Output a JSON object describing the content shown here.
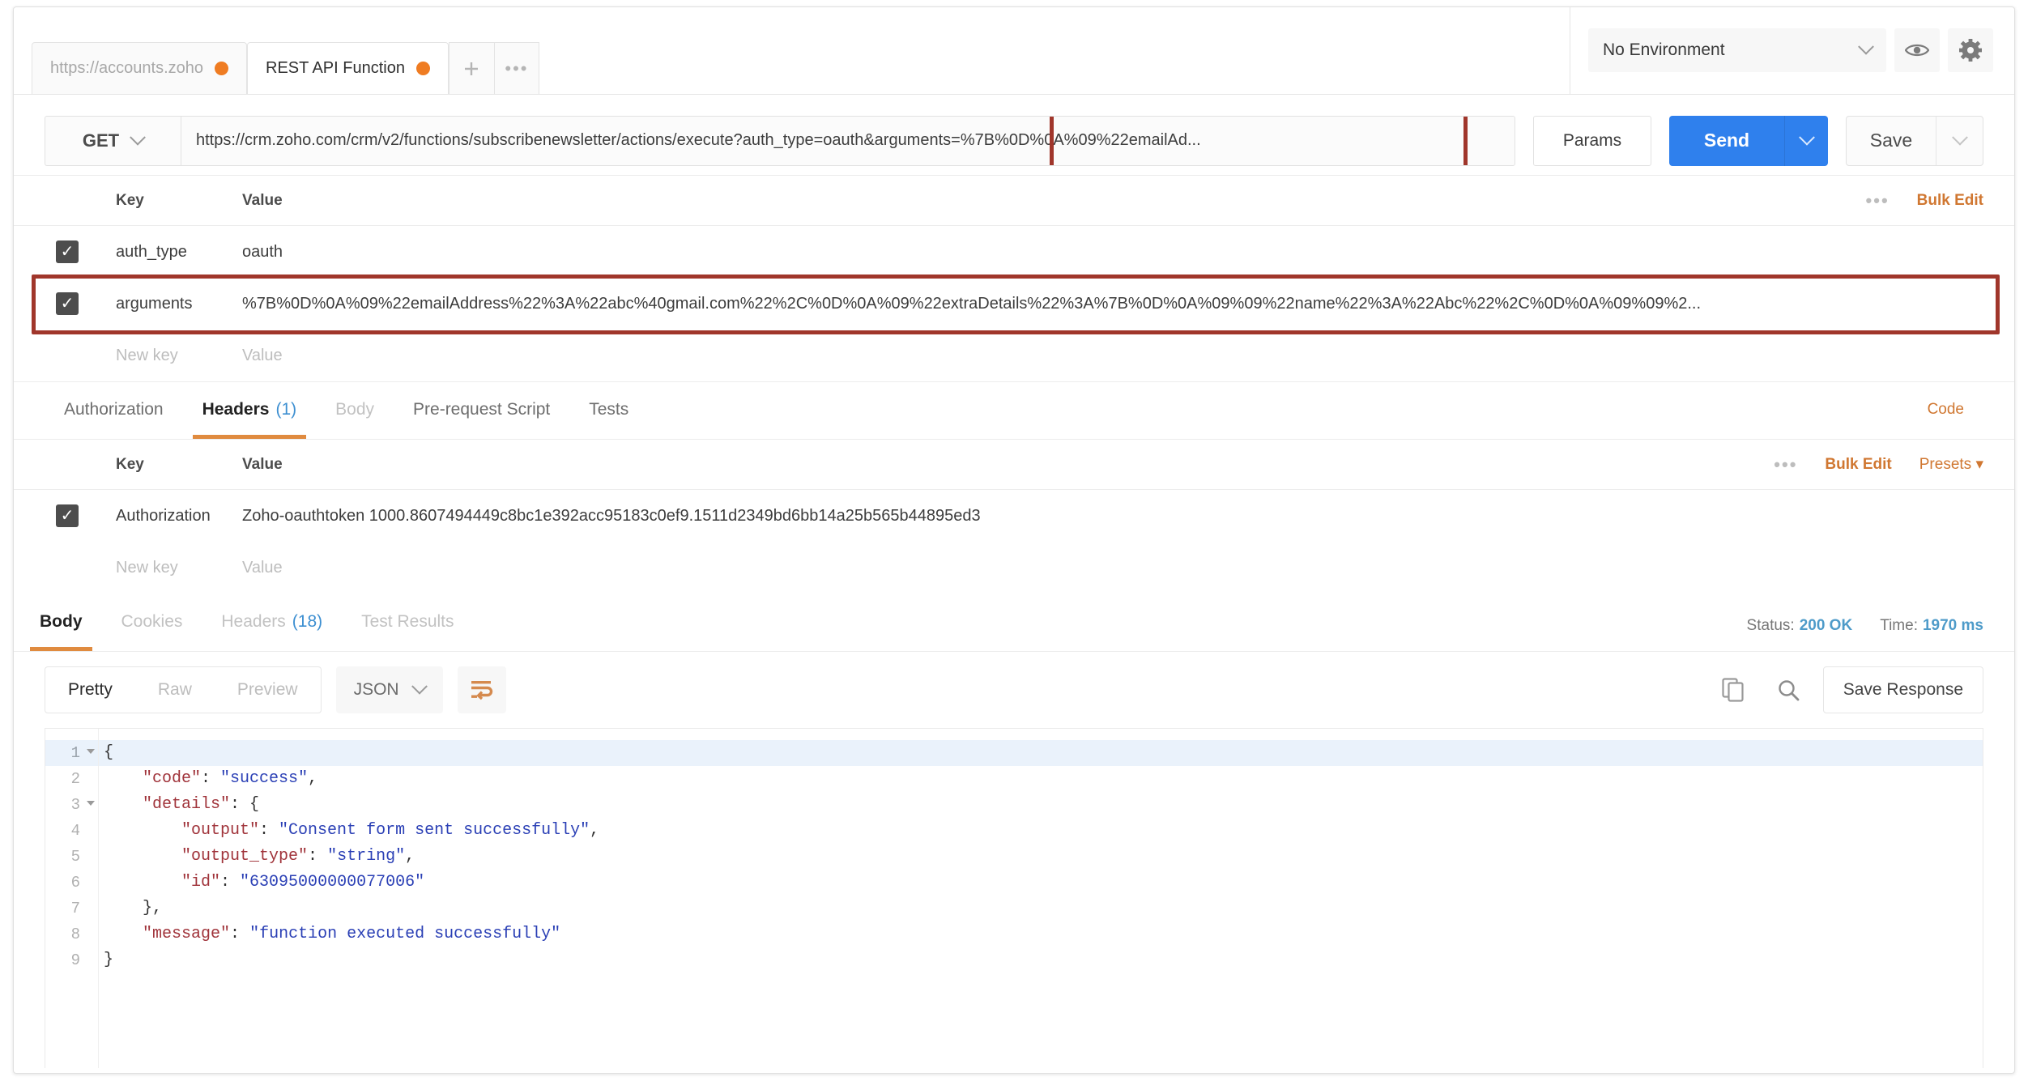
{
  "tabs": {
    "items": [
      {
        "label": "https://accounts.zoho",
        "active": false,
        "unsaved": true
      },
      {
        "label": "REST API Function",
        "active": true,
        "unsaved": true
      }
    ],
    "new_tab_icon": "plus-icon",
    "more_icon": "ellipsis-icon"
  },
  "environment": {
    "selected": "No Environment",
    "eye_icon": "eye-icon",
    "settings_icon": "gear-icon"
  },
  "request": {
    "method": "GET",
    "url": "https://crm.zoho.com/crm/v2/functions/subscribenewsletter/actions/execute?auth_type=oauth&arguments=%7B%0D%0A%09%22emailAd...",
    "params_label": "Params",
    "send_label": "Send",
    "save_label": "Save",
    "highlight_color": "#a0362b",
    "send_color": "#2f80ed"
  },
  "params_table": {
    "headers": {
      "key": "Key",
      "value": "Value"
    },
    "bulk_edit_label": "Bulk Edit",
    "more_icon": "ellipsis-icon",
    "rows": [
      {
        "checked": true,
        "key": "auth_type",
        "value": "oauth",
        "highlighted": false
      },
      {
        "checked": true,
        "key": "arguments",
        "value": "%7B%0D%0A%09%22emailAddress%22%3A%22abc%40gmail.com%22%2C%0D%0A%09%22extraDetails%22%3A%7B%0D%0A%09%09%22name%22%3A%22Abc%22%2C%0D%0A%09%09%2...",
        "highlighted": true
      }
    ],
    "new_row": {
      "key_placeholder": "New key",
      "value_placeholder": "Value"
    }
  },
  "request_tabs": {
    "items": [
      {
        "label": "Authorization",
        "state": "normal"
      },
      {
        "label": "Headers",
        "count": "(1)",
        "state": "active"
      },
      {
        "label": "Body",
        "state": "muted"
      },
      {
        "label": "Pre-request Script",
        "state": "normal"
      },
      {
        "label": "Tests",
        "state": "normal"
      }
    ],
    "code_label": "Code"
  },
  "headers_table": {
    "headers": {
      "key": "Key",
      "value": "Value"
    },
    "bulk_edit_label": "Bulk Edit",
    "presets_label": "Presets",
    "more_icon": "ellipsis-icon",
    "rows": [
      {
        "checked": true,
        "key": "Authorization",
        "value": "Zoho-oauthtoken 1000.8607494449c8bc1e392acc95183c0ef9.1511d2349bd6bb14a25b565b44895ed3"
      }
    ],
    "new_row": {
      "key_placeholder": "New key",
      "value_placeholder": "Value"
    }
  },
  "response": {
    "tabs": [
      {
        "label": "Body",
        "state": "active"
      },
      {
        "label": "Cookies",
        "state": "muted"
      },
      {
        "label": "Headers",
        "count": "(18)",
        "state": "muted"
      },
      {
        "label": "Test Results",
        "state": "muted"
      }
    ],
    "status_label": "Status:",
    "status_value": "200 OK",
    "time_label": "Time:",
    "time_value": "1970 ms",
    "view_modes": [
      {
        "label": "Pretty",
        "active": true
      },
      {
        "label": "Raw",
        "active": false
      },
      {
        "label": "Preview",
        "active": false
      }
    ],
    "format": "JSON",
    "wrap_icon": "word-wrap-icon",
    "copy_icon": "copy-icon",
    "search_icon": "search-icon",
    "save_response_label": "Save Response"
  },
  "response_body": {
    "lines": [
      {
        "n": "1",
        "fold": true,
        "indent": 0,
        "segments": [
          {
            "t": "pun",
            "v": "{"
          }
        ]
      },
      {
        "n": "2",
        "fold": false,
        "indent": 1,
        "segments": [
          {
            "t": "key",
            "v": "\"code\""
          },
          {
            "t": "pun",
            "v": ": "
          },
          {
            "t": "str",
            "v": "\"success\""
          },
          {
            "t": "pun",
            "v": ","
          }
        ]
      },
      {
        "n": "3",
        "fold": true,
        "indent": 1,
        "segments": [
          {
            "t": "key",
            "v": "\"details\""
          },
          {
            "t": "pun",
            "v": ": {"
          }
        ]
      },
      {
        "n": "4",
        "fold": false,
        "indent": 2,
        "segments": [
          {
            "t": "key",
            "v": "\"output\""
          },
          {
            "t": "pun",
            "v": ": "
          },
          {
            "t": "str",
            "v": "\"Consent form sent successfully\""
          },
          {
            "t": "pun",
            "v": ","
          }
        ]
      },
      {
        "n": "5",
        "fold": false,
        "indent": 2,
        "segments": [
          {
            "t": "key",
            "v": "\"output_type\""
          },
          {
            "t": "pun",
            "v": ": "
          },
          {
            "t": "str",
            "v": "\"string\""
          },
          {
            "t": "pun",
            "v": ","
          }
        ]
      },
      {
        "n": "6",
        "fold": false,
        "indent": 2,
        "segments": [
          {
            "t": "key",
            "v": "\"id\""
          },
          {
            "t": "pun",
            "v": ": "
          },
          {
            "t": "str",
            "v": "\"63095000000077006\""
          }
        ]
      },
      {
        "n": "7",
        "fold": false,
        "indent": 1,
        "segments": [
          {
            "t": "pun",
            "v": "},"
          }
        ]
      },
      {
        "n": "8",
        "fold": false,
        "indent": 1,
        "segments": [
          {
            "t": "key",
            "v": "\"message\""
          },
          {
            "t": "pun",
            "v": ": "
          },
          {
            "t": "str",
            "v": "\"function executed successfully\""
          }
        ]
      },
      {
        "n": "9",
        "fold": false,
        "indent": 0,
        "segments": [
          {
            "t": "pun",
            "v": "}"
          }
        ]
      }
    ]
  }
}
